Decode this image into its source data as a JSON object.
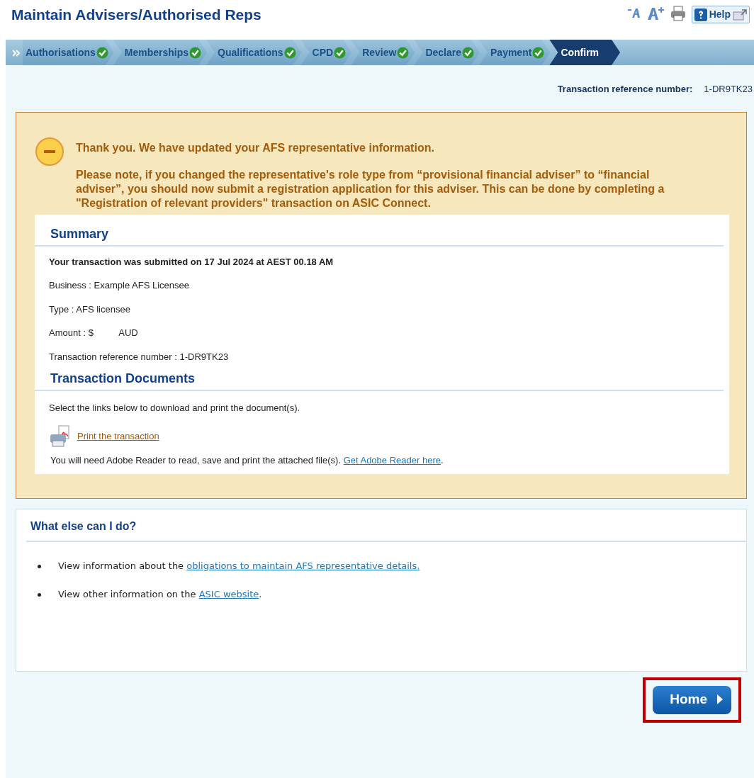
{
  "page_title": "Maintain Advisers/Authorised Reps",
  "toolbar": {
    "help_label": "Help"
  },
  "steps": [
    {
      "label": "Authorisations",
      "completed": true,
      "selected": false
    },
    {
      "label": "Memberships",
      "completed": true,
      "selected": false
    },
    {
      "label": "Qualifications",
      "completed": true,
      "selected": false
    },
    {
      "label": "CPD",
      "completed": true,
      "selected": false
    },
    {
      "label": "Review",
      "completed": true,
      "selected": false
    },
    {
      "label": "Declare",
      "completed": true,
      "selected": false
    },
    {
      "label": "Payment",
      "completed": true,
      "selected": false
    },
    {
      "label": "Confirm",
      "completed": false,
      "selected": true
    }
  ],
  "reference": {
    "label": "Transaction reference number:",
    "value": "1-DR9TK23"
  },
  "notice": {
    "heading": "Thank you. We have updated your AFS representative information.",
    "body": "Please note, if you changed the representative's role type from “provisional financial adviser” to “financial adviser”, you should now submit a registration application for this adviser. This can be done by completing a \"Registration of relevant providers\" transaction on ASIC Connect."
  },
  "summary": {
    "heading": "Summary",
    "lines": [
      {
        "text": "Your transaction was submitted on 17 Jul 2024 at AEST 00.18 AM",
        "bold": true
      },
      {
        "text": "Business : Example AFS Licensee",
        "bold": false
      },
      {
        "text": "Type : AFS licensee",
        "bold": false
      },
      {
        "text": "Amount : $          AUD",
        "bold": false
      },
      {
        "text": "Transaction reference number : 1-DR9TK23",
        "bold": false
      }
    ]
  },
  "documents": {
    "heading": "Transaction Documents",
    "intro": "Select the links below to download and print the document(s).",
    "print_link": "Print the transaction",
    "reader_note": "You will need Adobe Reader to read, save and print the attached file(s).",
    "reader_link": "Get Adobe Reader here",
    "reader_end": "."
  },
  "what_else": {
    "heading": "What else can I do?",
    "items": [
      {
        "text": "View information about the",
        "link": "obligations to maintain AFS representative details."
      },
      {
        "text": "View other information on the",
        "link": "ASIC website",
        "after": "."
      }
    ]
  },
  "home_button": {
    "label": "Home",
    "highlighted": true
  }
}
